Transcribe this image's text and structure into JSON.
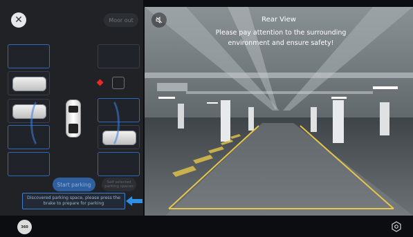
{
  "left_panel": {
    "moor_out_label": "Moor out",
    "start_parking_label": "Start parking",
    "self_select_label": "Self selected\nparking spaces",
    "tooltip_text": "Discovered parking space, please press the\nbrake to prepare for parking"
  },
  "camera": {
    "title": "Rear View",
    "warning": "Please pay attention to the surrounding\nenvironment and ensure safety!"
  },
  "bottom_bar": {
    "cam360_label": "360"
  },
  "colors": {
    "accent_blue": "#3f7fd0",
    "guide_yellow": "#e7c64a",
    "alert_red": "#e62b2b"
  },
  "icons": [
    "close-icon",
    "mute-icon",
    "camera-360-icon",
    "settings-icon",
    "arrow-left-icon"
  ]
}
